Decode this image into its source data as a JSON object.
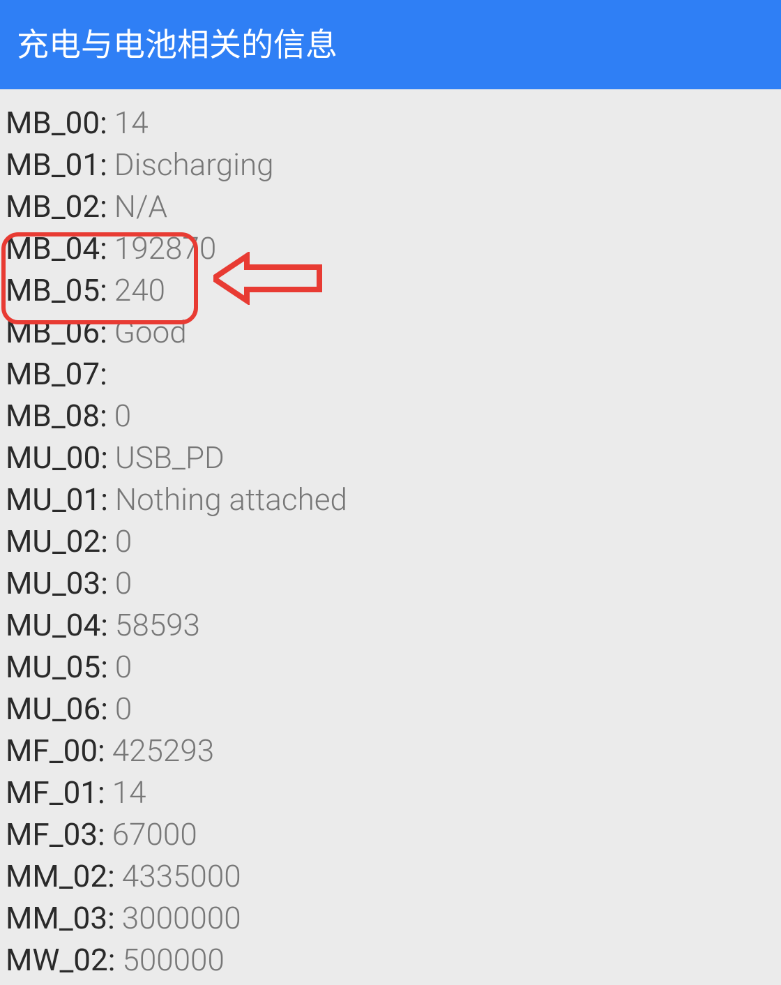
{
  "header": {
    "title": "充电与电池相关的信息"
  },
  "rows": [
    {
      "key": "MB_00",
      "value": "14"
    },
    {
      "key": "MB_01",
      "value": "Discharging"
    },
    {
      "key": "MB_02",
      "value": "N/A"
    },
    {
      "key": "MB_04",
      "value": "192870"
    },
    {
      "key": "MB_05",
      "value": "240"
    },
    {
      "key": "MB_06",
      "value": "Good"
    },
    {
      "key": "MB_07",
      "value": ""
    },
    {
      "key": "MB_08",
      "value": "0"
    },
    {
      "key": "MU_00",
      "value": "USB_PD"
    },
    {
      "key": "MU_01",
      "value": "Nothing attached"
    },
    {
      "key": "MU_02",
      "value": "0"
    },
    {
      "key": "MU_03",
      "value": "0"
    },
    {
      "key": "MU_04",
      "value": "58593"
    },
    {
      "key": "MU_05",
      "value": "0"
    },
    {
      "key": "MU_06",
      "value": "0"
    },
    {
      "key": "MF_00",
      "value": "425293"
    },
    {
      "key": "MF_01",
      "value": "14"
    },
    {
      "key": "MF_03",
      "value": "67000"
    },
    {
      "key": "MM_02",
      "value": "4335000"
    },
    {
      "key": "MM_03",
      "value": "3000000"
    },
    {
      "key": "MW_02",
      "value": "500000"
    }
  ],
  "annotations": {
    "highlight_color": "#e83b33"
  }
}
